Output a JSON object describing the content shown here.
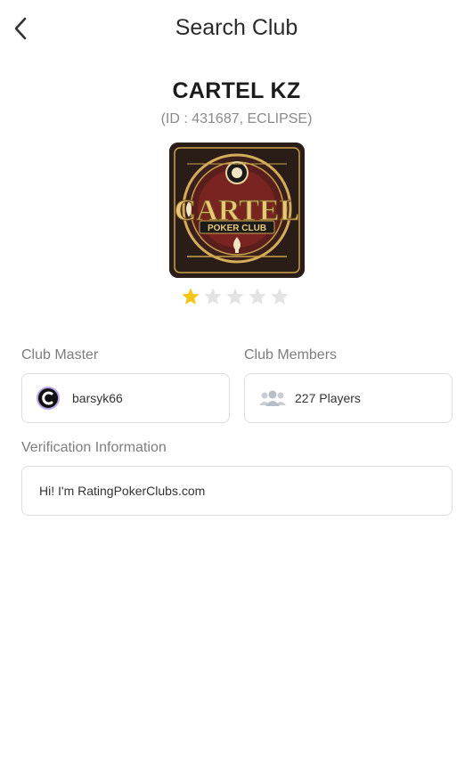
{
  "header": {
    "title": "Search Club"
  },
  "club": {
    "name": "CARTEL KZ",
    "id_line": "(ID : 431687, ECLIPSE)",
    "logo": {
      "title": "CARTEL",
      "subtitle": "POKER CLUB"
    },
    "rating": 1,
    "rating_max": 5,
    "colors": {
      "star_filled": "#f5c518",
      "star_empty": "#e3e3e3"
    }
  },
  "master": {
    "label": "Club Master",
    "name": "barsyk66"
  },
  "members": {
    "label": "Club Members",
    "count_text": "227 Players"
  },
  "verification": {
    "label": "Verification Information",
    "text": "Hi! I'm RatingPokerClubs.com"
  }
}
